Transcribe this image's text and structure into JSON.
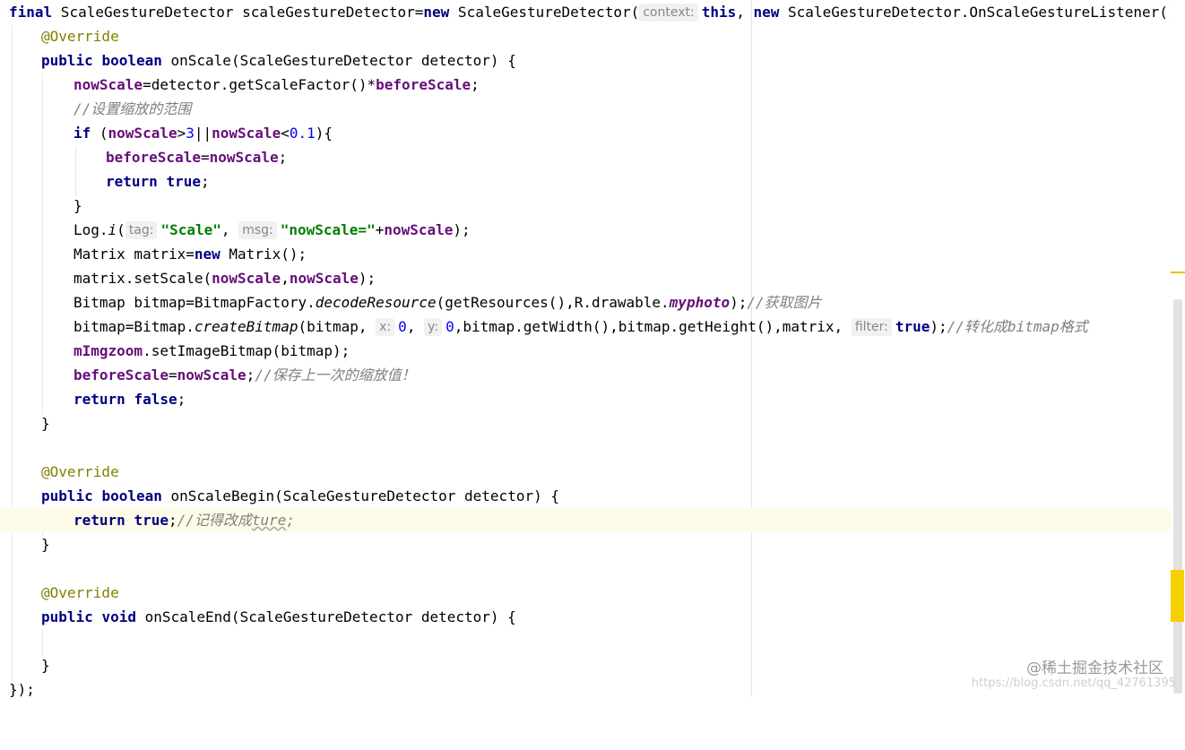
{
  "code": {
    "l1": {
      "kw_final": "final",
      "decl": " ScaleGestureDetector scaleGestureDetector=",
      "kw_new": "new",
      "ctor": " ScaleGestureDetector(",
      "hint_context": "context:",
      "kw_this": "this",
      "comma": ", ",
      "kw_new2": "new",
      "listener": " ScaleGestureDetector.OnScaleGestureListener() {"
    },
    "l2": {
      "annotation": "@Override"
    },
    "l3": {
      "kw_public": "public",
      "kw_boolean": "boolean",
      "sig": " onScale(ScaleGestureDetector detector) {"
    },
    "l4": {
      "field_now": "nowScale",
      "mid": "=detector.getScaleFactor()*",
      "field_before": "beforeScale",
      "end": ";"
    },
    "l5": {
      "comment": "//设置缩放的范围"
    },
    "l6": {
      "kw_if": "if",
      "open": " (",
      "field_now": "nowScale",
      "gt": ">",
      "num3": "3",
      "or": "||",
      "field_now2": "nowScale",
      "lt": "<",
      "num01": "0.1",
      "close": "){"
    },
    "l7": {
      "field_before": "beforeScale",
      "eq": "=",
      "field_now": "nowScale",
      "end": ";"
    },
    "l8": {
      "kw_return": "return",
      "kw_true": "true",
      "end": ";"
    },
    "l9": {
      "brace": "}"
    },
    "l10": {
      "log": "Log.",
      "method_i": "i",
      "paren": "(",
      "hint_tag": "tag:",
      "str_scale": "\"Scale\"",
      "comma": ", ",
      "hint_msg": "msg:",
      "str_now": "\"nowScale=\"",
      "plus": "+",
      "field_now": "nowScale",
      "end": ");"
    },
    "l11": {
      "decl": "Matrix matrix=",
      "kw_new": "new",
      "rest": " Matrix();"
    },
    "l12": {
      "call": "matrix.setScale(",
      "field_now": "nowScale",
      "comma": ",",
      "field_now2": "nowScale",
      "end": ");"
    },
    "l13": {
      "decl": "Bitmap bitmap=BitmapFactory.",
      "method": "decodeResource",
      "args": "(getResources(),R.drawable.",
      "field_photo": "myphoto",
      "end": ");",
      "comment": "//获取图片"
    },
    "l14": {
      "assign": "bitmap=Bitmap.",
      "method": "createBitmap",
      "args1": "(bitmap, ",
      "hint_x": "x:",
      "num_x": "0",
      "comma": ", ",
      "hint_y": "y:",
      "num_y": "0",
      "args2": ",bitmap.getWidth(),bitmap.getHeight(),matrix, ",
      "hint_filter": "filter:",
      "kw_true": "true",
      "end": ");",
      "comment": "//转化成bitmap格式"
    },
    "l15": {
      "field_img": "mImgzoom",
      "rest": ".setImageBitmap(bitmap);"
    },
    "l16": {
      "field_before": "beforeScale",
      "eq": "=",
      "field_now": "nowScale",
      "end": ";",
      "comment": "//保存上一次的缩放值！"
    },
    "l17": {
      "kw_return": "return",
      "kw_false": "false",
      "end": ";"
    },
    "l18": {
      "brace": "}"
    },
    "l20": {
      "annotation": "@Override"
    },
    "l21": {
      "kw_public": "public",
      "kw_boolean": "boolean",
      "sig": " onScaleBegin(ScaleGestureDetector detector) {"
    },
    "l22": {
      "kw_return": "return",
      "kw_true": "true",
      "end": ";",
      "comment_prefix": "//记得改成",
      "comment_typo": "ture",
      "comment_suffix": ";"
    },
    "l23": {
      "brace": "}"
    },
    "l25": {
      "annotation": "@Override"
    },
    "l26": {
      "kw_public": "public",
      "kw_void": "void",
      "sig": " onScaleEnd(ScaleGestureDetector detector) {"
    },
    "l28": {
      "brace": "}"
    },
    "l29": {
      "close": "});"
    }
  },
  "watermark": {
    "text": "@稀土掘金技术社区",
    "url": "https://blog.csdn.net/qq_42761395"
  },
  "colors": {
    "keyword": "#000080",
    "annotation": "#808000",
    "field": "#660e7a",
    "string": "#008000",
    "number": "#0000ff",
    "comment": "#808080",
    "current_line": "#fefce8"
  }
}
